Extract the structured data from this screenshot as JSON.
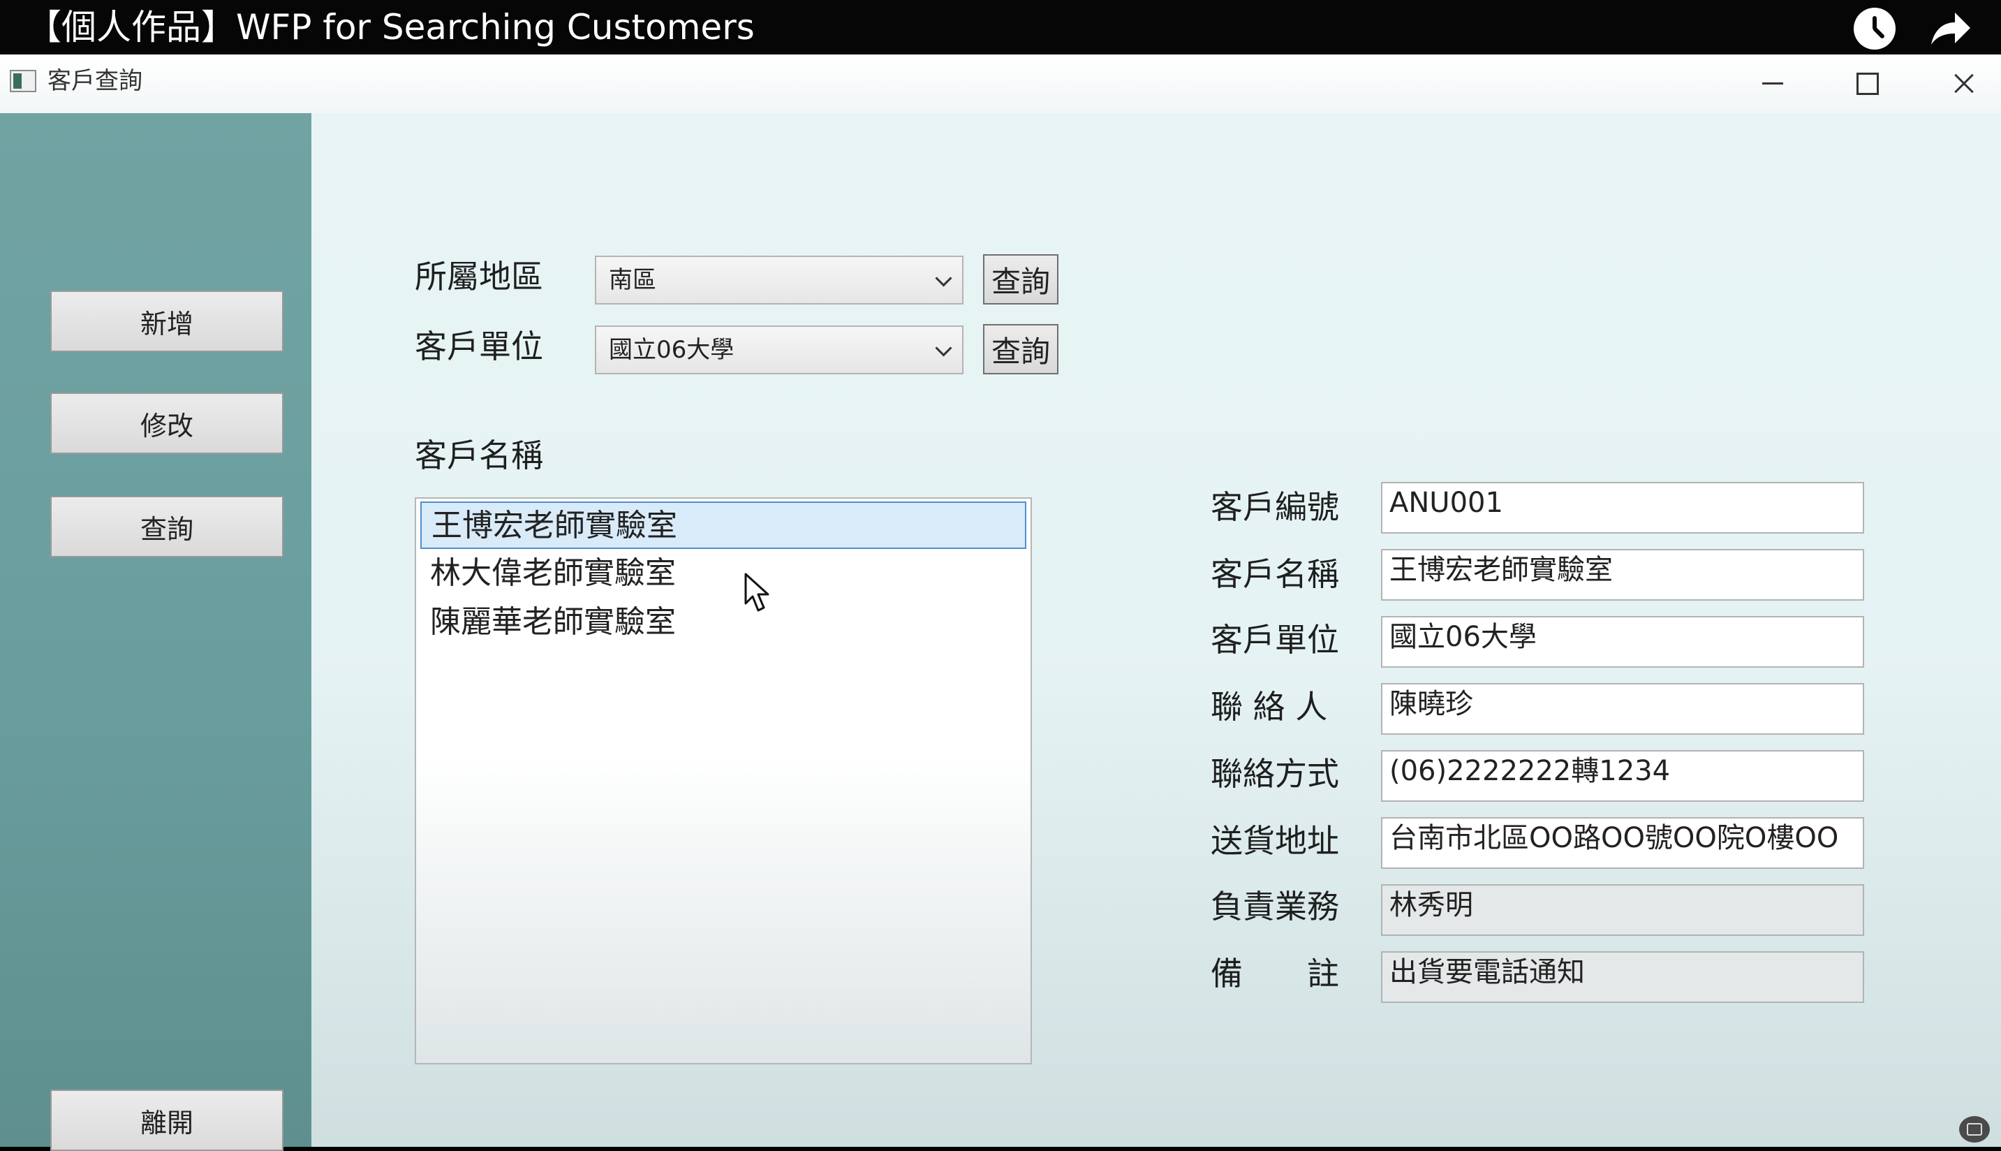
{
  "video": {
    "title": "【個人作品】WFP for Searching Customers",
    "icons": [
      "clock-icon",
      "share-icon"
    ]
  },
  "window": {
    "title": "客戶查詢"
  },
  "sidebar": {
    "add_label": "新增",
    "edit_label": "修改",
    "search_label": "查詢",
    "exit_label": "離開"
  },
  "filters": {
    "region_label": "所屬地區",
    "region_value": "南區",
    "region_query": "查詢",
    "unit_label": "客戶單位",
    "unit_value": "國立06大學",
    "unit_query": "查詢"
  },
  "list": {
    "label": "客戶名稱",
    "items": [
      "王博宏老師實驗室",
      "林大偉老師實驗室",
      "陳麗華老師實驗室"
    ],
    "selected_index": 0
  },
  "details": {
    "id_label": "客戶編號",
    "id_value": "ANU001",
    "name_label": "客戶名稱",
    "name_value": "王博宏老師實驗室",
    "unit_label": "客戶單位",
    "unit_value": "國立06大學",
    "contact_label": "聯 絡 人",
    "contact_value": "陳曉珍",
    "phone_label": "聯絡方式",
    "phone_value": "(06)2222222轉1234",
    "address_label": "送貨地址",
    "address_value": "台南市北區OO路OO號OO院O樓OO",
    "sales_label": "負責業務",
    "sales_value": "林秀明",
    "note_label": "備　　註",
    "note_value": "出貨要電話通知"
  },
  "colors": {
    "sidebar": "#6a9e9e",
    "selection": "#d9ebf9",
    "selection_border": "#4f8fd0"
  }
}
